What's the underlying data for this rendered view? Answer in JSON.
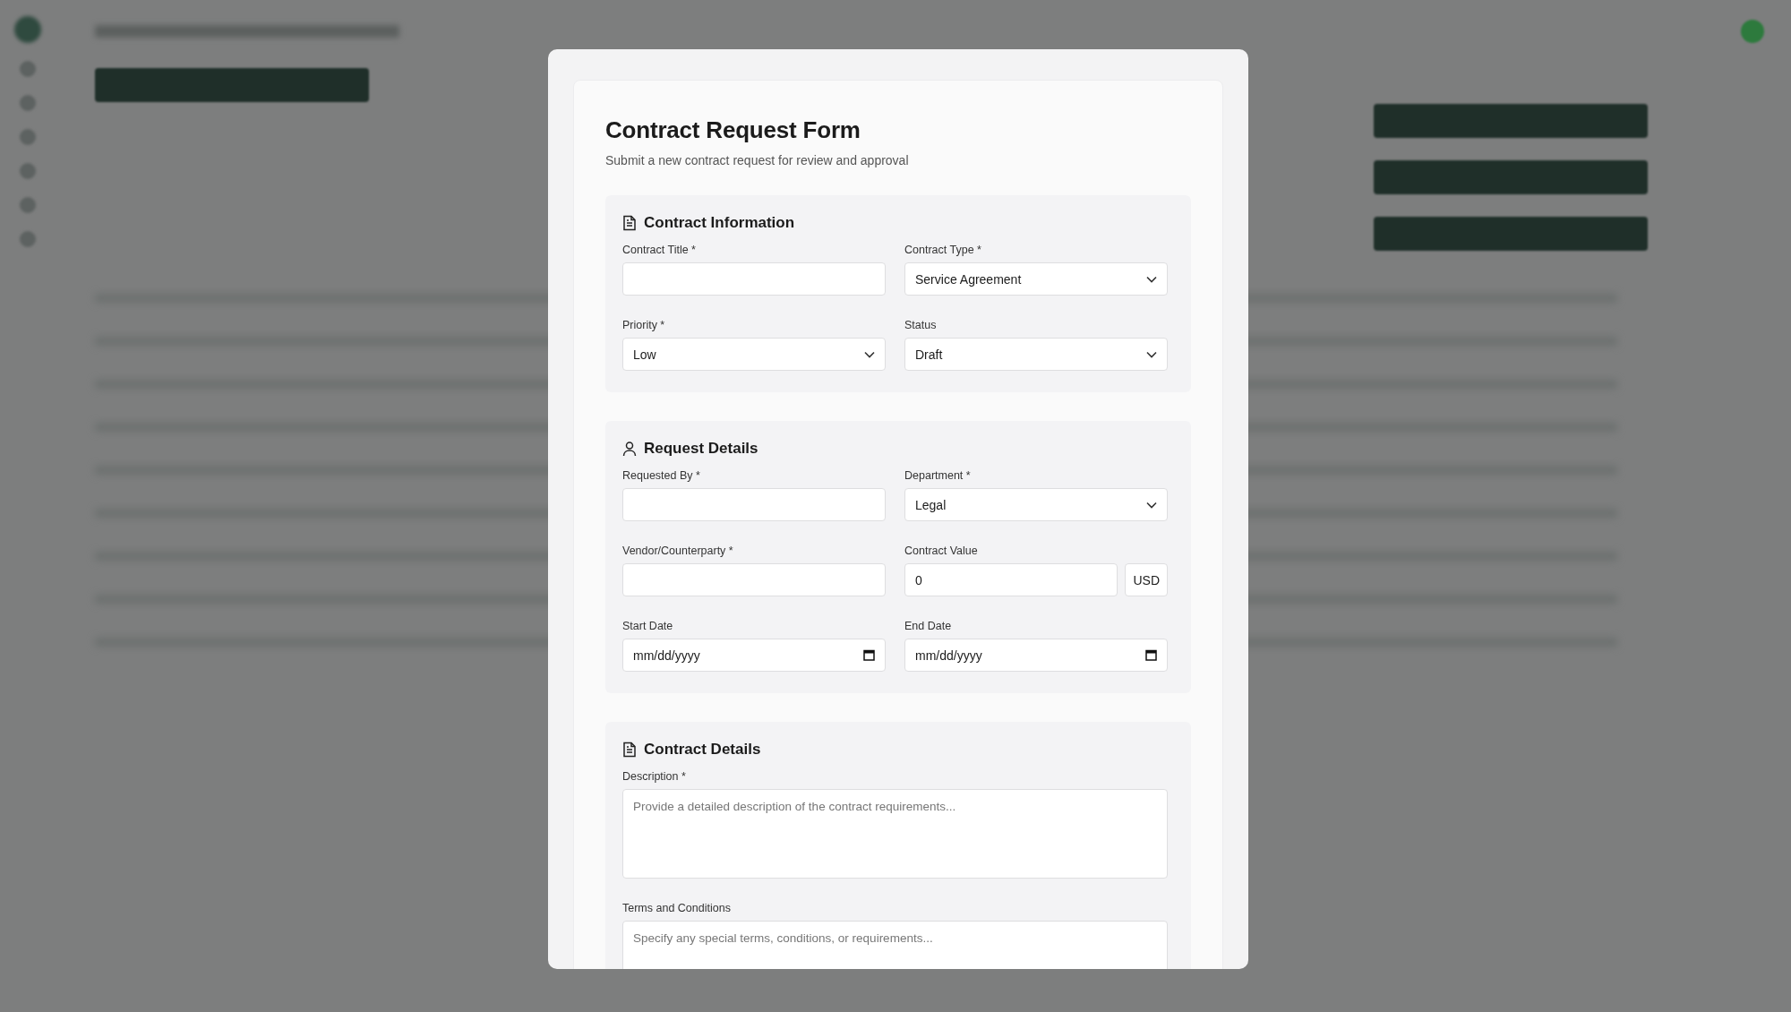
{
  "form": {
    "title": "Contract Request Form",
    "subtitle": "Submit a new contract request for review and approval",
    "sections": [
      {
        "kind": "document",
        "title": "Contract Information",
        "fields": [
          {
            "kind": "text",
            "label": "Contract Title *"
          },
          {
            "kind": "select",
            "label": "Contract Type *",
            "value": "Service Agreement"
          },
          {
            "kind": "select",
            "label": "Priority *",
            "value": "Low"
          },
          {
            "kind": "select",
            "label": "Status",
            "value": "Draft"
          }
        ]
      },
      {
        "kind": "person",
        "title": "Request Details",
        "fields": [
          {
            "kind": "text",
            "label": "Requested By *"
          },
          {
            "kind": "select",
            "label": "Department *",
            "value": "Legal"
          },
          {
            "kind": "text",
            "label": "Vendor/Counterparty *"
          },
          {
            "kind": "currency",
            "label": "Contract Value",
            "value": "0",
            "unit": "USD"
          },
          {
            "kind": "date",
            "label": "Start Date",
            "value": "mm/dd/yyyy"
          },
          {
            "kind": "date",
            "label": "End Date",
            "value": "mm/dd/yyyy"
          }
        ]
      },
      {
        "kind": "document",
        "title": "Contract Details",
        "fields": [
          {
            "kind": "textarea",
            "label": "Description *",
            "placeholder": "Provide a detailed description of the contract requirements..."
          },
          {
            "kind": "textarea",
            "label": "Terms and Conditions",
            "placeholder": "Specify any special terms, conditions, or requirements..."
          }
        ]
      }
    ]
  }
}
